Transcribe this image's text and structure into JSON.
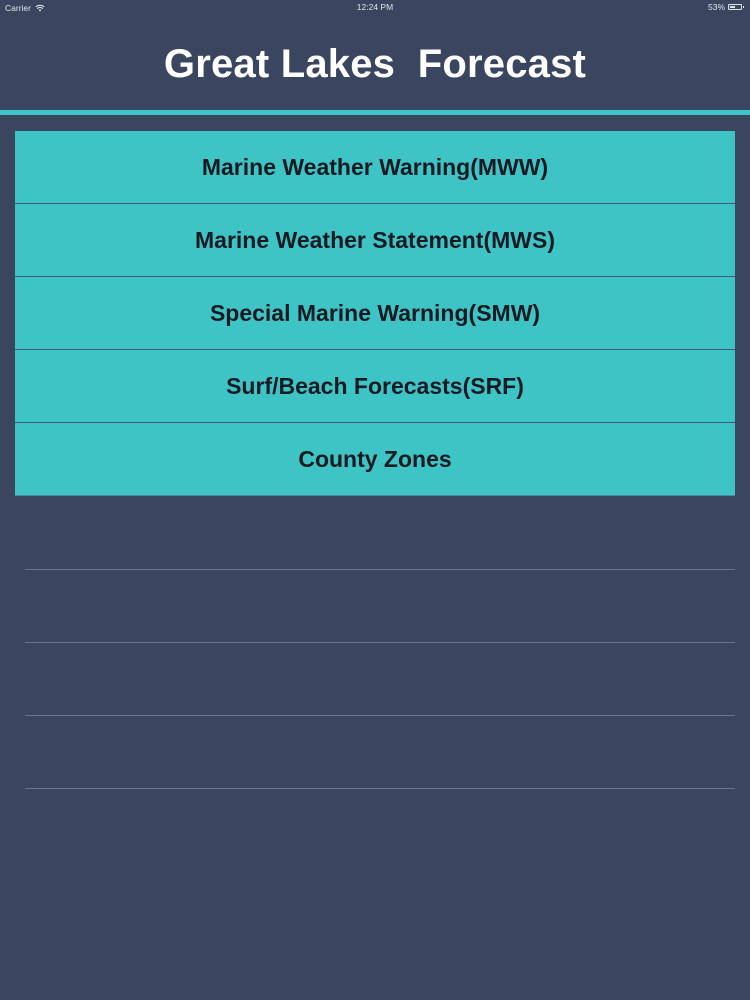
{
  "status_bar": {
    "carrier": "Carrier",
    "time": "12:24 PM",
    "battery": "53%",
    "battery_level": 0.53,
    "wifi_icon": "wifi-icon",
    "battery_icon": "battery-icon"
  },
  "header": {
    "title": "Great Lakes  Forecast"
  },
  "menu": {
    "items": [
      {
        "label": "Marine Weather Warning(MWW)"
      },
      {
        "label": "Marine Weather Statement(MWS)"
      },
      {
        "label": "Special Marine Warning(SMW)"
      },
      {
        "label": "Surf/Beach Forecasts(SRF)"
      },
      {
        "label": "County Zones"
      }
    ]
  },
  "colors": {
    "background": "#3a4660",
    "accent": "#3ec4c4",
    "row_text": "#141a24",
    "title_text": "#ffffff"
  }
}
